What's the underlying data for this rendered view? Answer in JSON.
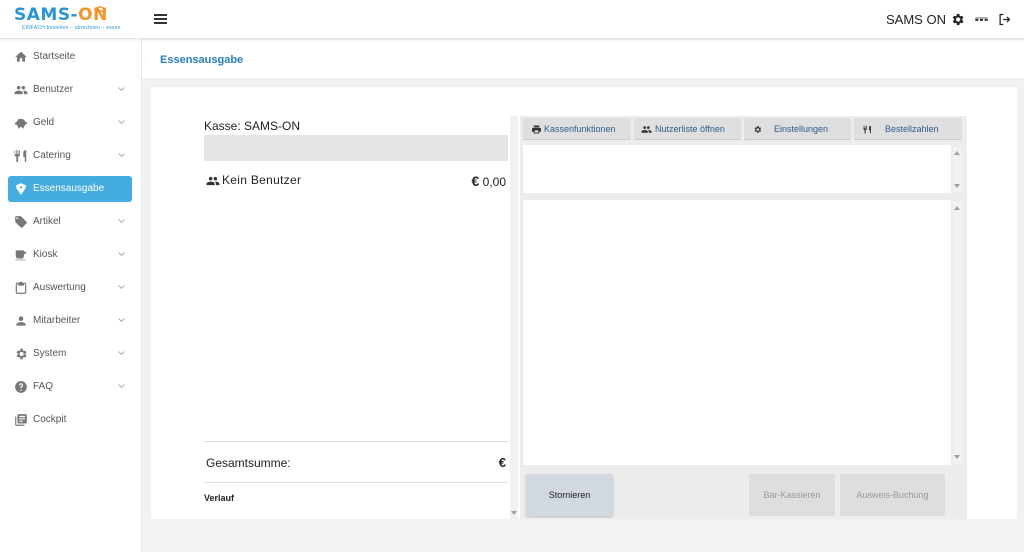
{
  "header": {
    "logo_main": "SAMS-",
    "logo_accent": "ON",
    "logo_tagline": "EINFACH bestellen – abrechnen – essen",
    "user_name": "SAMS ON",
    "brand_color": "#2a95d3",
    "accent_color": "#f0952a"
  },
  "sidebar": {
    "active_color": "#45ace0",
    "items": [
      {
        "label": "Startseite",
        "icon": "home-icon"
      },
      {
        "label": "Benutzer",
        "icon": "users-icon"
      },
      {
        "label": "Geld",
        "icon": "piggy-bank-icon"
      },
      {
        "label": "Catering",
        "icon": "cutlery-icon"
      },
      {
        "label": "Essensausgabe",
        "icon": "tag-icon"
      },
      {
        "label": "Artikel",
        "icon": "label-icon"
      },
      {
        "label": "Kiosk",
        "icon": "cup-icon"
      },
      {
        "label": "Auswertung",
        "icon": "clipboard-icon"
      },
      {
        "label": "Mitarbeiter",
        "icon": "person-icon"
      },
      {
        "label": "System",
        "icon": "gear-icon"
      },
      {
        "label": "FAQ",
        "icon": "help-icon"
      },
      {
        "label": "Cockpit",
        "icon": "library-icon"
      }
    ]
  },
  "page": {
    "breadcrumb": "Essensausgabe"
  },
  "kasse": {
    "title": "Kasse: SAMS-ON",
    "user_label": "Kein Benutzer",
    "currency": "€",
    "user_amount": "0,00",
    "total_label": "Gesamtsumme:",
    "total_currency": "€",
    "history_label": "Verlauf"
  },
  "toolbar": {
    "kassenfunktionen": "Kassenfunktionen",
    "nutzerliste": "Nutzerliste öffnen",
    "einstellungen": "Einstellungen",
    "bestellzahlen": "Bestellzahlen"
  },
  "actions": {
    "stornieren": "Stornieren",
    "bar_kassieren": "Bar-Kassieren",
    "ausweis_buchung": "Ausweis-Buchung"
  }
}
